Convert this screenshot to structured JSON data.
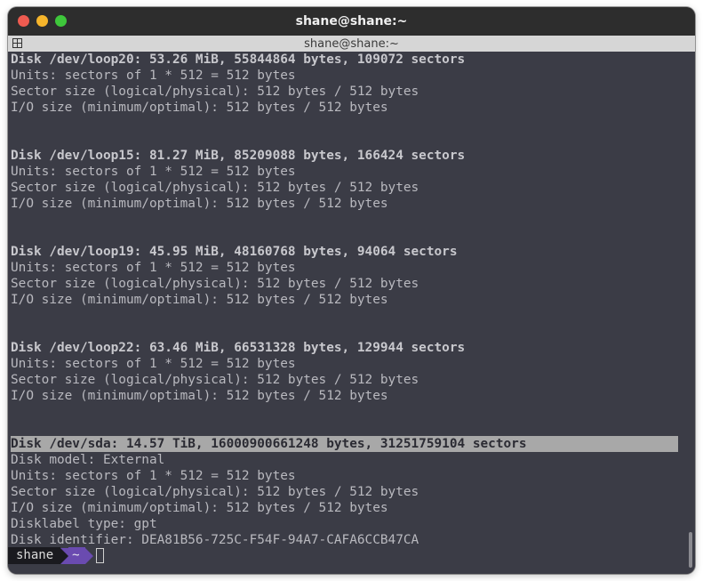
{
  "window": {
    "title": "shane@shane:~",
    "tab_title": "shane@shane:~"
  },
  "terminal": {
    "lines": [
      {
        "text": "Disk /dev/loop20: 53.26 MiB, 55844864 bytes, 109072 sectors",
        "style": "bold"
      },
      {
        "text": "Units: sectors of 1 * 512 = 512 bytes",
        "style": "normal"
      },
      {
        "text": "Sector size (logical/physical): 512 bytes / 512 bytes",
        "style": "normal"
      },
      {
        "text": "I/O size (minimum/optimal): 512 bytes / 512 bytes",
        "style": "normal"
      },
      {
        "text": "",
        "style": "normal"
      },
      {
        "text": "",
        "style": "normal"
      },
      {
        "text": "Disk /dev/loop15: 81.27 MiB, 85209088 bytes, 166424 sectors",
        "style": "bold"
      },
      {
        "text": "Units: sectors of 1 * 512 = 512 bytes",
        "style": "normal"
      },
      {
        "text": "Sector size (logical/physical): 512 bytes / 512 bytes",
        "style": "normal"
      },
      {
        "text": "I/O size (minimum/optimal): 512 bytes / 512 bytes",
        "style": "normal"
      },
      {
        "text": "",
        "style": "normal"
      },
      {
        "text": "",
        "style": "normal"
      },
      {
        "text": "Disk /dev/loop19: 45.95 MiB, 48160768 bytes, 94064 sectors",
        "style": "bold"
      },
      {
        "text": "Units: sectors of 1 * 512 = 512 bytes",
        "style": "normal"
      },
      {
        "text": "Sector size (logical/physical): 512 bytes / 512 bytes",
        "style": "normal"
      },
      {
        "text": "I/O size (minimum/optimal): 512 bytes / 512 bytes",
        "style": "normal"
      },
      {
        "text": "",
        "style": "normal"
      },
      {
        "text": "",
        "style": "normal"
      },
      {
        "text": "Disk /dev/loop22: 63.46 MiB, 66531328 bytes, 129944 sectors",
        "style": "bold"
      },
      {
        "text": "Units: sectors of 1 * 512 = 512 bytes",
        "style": "normal"
      },
      {
        "text": "Sector size (logical/physical): 512 bytes / 512 bytes",
        "style": "normal"
      },
      {
        "text": "I/O size (minimum/optimal): 512 bytes / 512 bytes",
        "style": "normal"
      },
      {
        "text": "",
        "style": "normal"
      },
      {
        "text": "",
        "style": "normal"
      },
      {
        "text": "Disk /dev/sda: 14.57 TiB, 16000900661248 bytes, 31251759104 sectors",
        "style": "hl"
      },
      {
        "text": "Disk model: External",
        "style": "normal"
      },
      {
        "text": "Units: sectors of 1 * 512 = 512 bytes",
        "style": "normal"
      },
      {
        "text": "Sector size (logical/physical): 512 bytes / 512 bytes",
        "style": "normal"
      },
      {
        "text": "I/O size (minimum/optimal): 512 bytes / 512 bytes",
        "style": "normal"
      },
      {
        "text": "Disklabel type: gpt",
        "style": "normal"
      },
      {
        "text": "Disk identifier: DEA81B56-725C-F54F-94A7-CAFA6CCB47CA",
        "style": "normal"
      }
    ]
  },
  "prompt": {
    "user": "shane",
    "dir": "~"
  },
  "colors": {
    "terminal_bg": "#3b3c46",
    "text": "#b9b9bf",
    "highlight": "#a8a8a8",
    "prompt_user_bg": "#1a1a1f",
    "prompt_dir_bg": "#6a4bb0",
    "close": "#ee5b50",
    "minimize": "#f6b52b",
    "maximize": "#3ec73b"
  },
  "icons": {
    "tab_icon": "terminal-tab-icon",
    "close": "close-icon",
    "minimize": "minimize-icon",
    "maximize": "maximize-icon"
  }
}
